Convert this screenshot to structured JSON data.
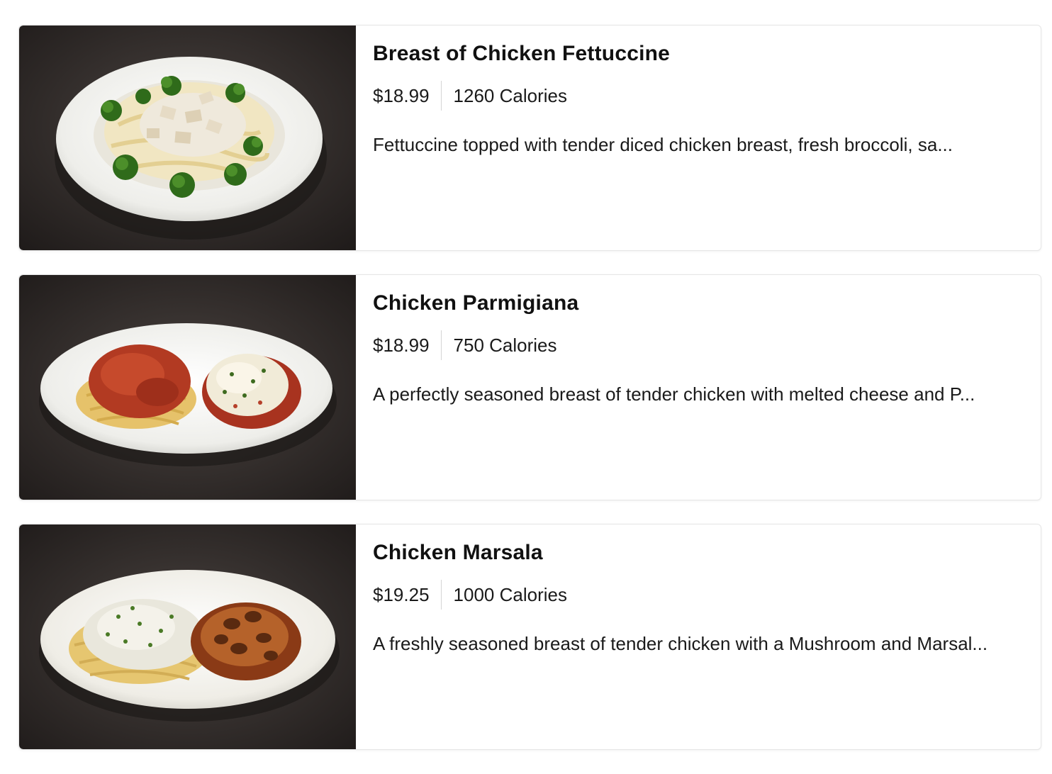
{
  "menu": {
    "items": [
      {
        "name": "Breast of Chicken Fettuccine",
        "price": "$18.99",
        "calories": "1260 Calories",
        "description": "Fettuccine topped with tender diced chicken breast, fresh broccoli, sa..."
      },
      {
        "name": "Chicken Parmigiana",
        "price": "$18.99",
        "calories": "750 Calories",
        "description": "A perfectly seasoned breast of tender chicken with melted cheese and P..."
      },
      {
        "name": "Chicken Marsala",
        "price": "$19.25",
        "calories": "1000 Calories",
        "description": "A freshly seasoned breast of tender chicken with a Mushroom and Marsal..."
      }
    ]
  },
  "colors": {
    "photo_background": "#2b2624",
    "plate": "#f1f1ec",
    "card_border": "#e6e6e6",
    "text": "#111111"
  }
}
